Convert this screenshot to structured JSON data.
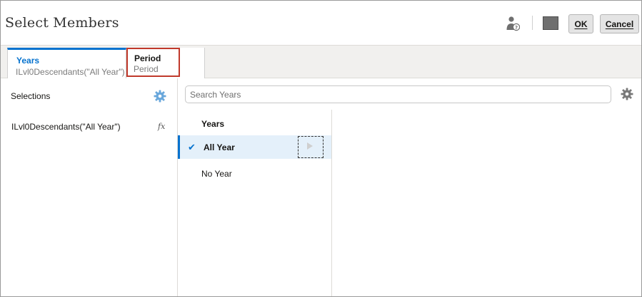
{
  "dialog": {
    "title": "Select Members",
    "ok_label": "OK",
    "cancel_label": "Cancel"
  },
  "tabs": [
    {
      "label": "Years",
      "sub": "ILvl0Descendants(\"All Year\")",
      "active": true
    },
    {
      "label": "Period",
      "sub": "Period",
      "active": false
    }
  ],
  "selections": {
    "title": "Selections",
    "items": [
      {
        "label": "ILvl0Descendants(\"All Year\")",
        "badge": "fx"
      }
    ]
  },
  "search": {
    "placeholder": "Search Years",
    "value": ""
  },
  "tree": {
    "header": "Years",
    "rows": [
      {
        "label": "All Year",
        "checked": true
      },
      {
        "label": "No Year",
        "checked": false
      }
    ]
  },
  "icons": {
    "user_help": "user-help-icon",
    "layout": "layout-square-icon",
    "gear": "gear-icon",
    "check": "checkmark-icon",
    "drill": "drill-right-icon"
  },
  "colors": {
    "accent": "#0572ce",
    "highlight": "#c0392b",
    "selected_row": "#e4f0fa",
    "gear_blue": "#6aa8dc"
  }
}
